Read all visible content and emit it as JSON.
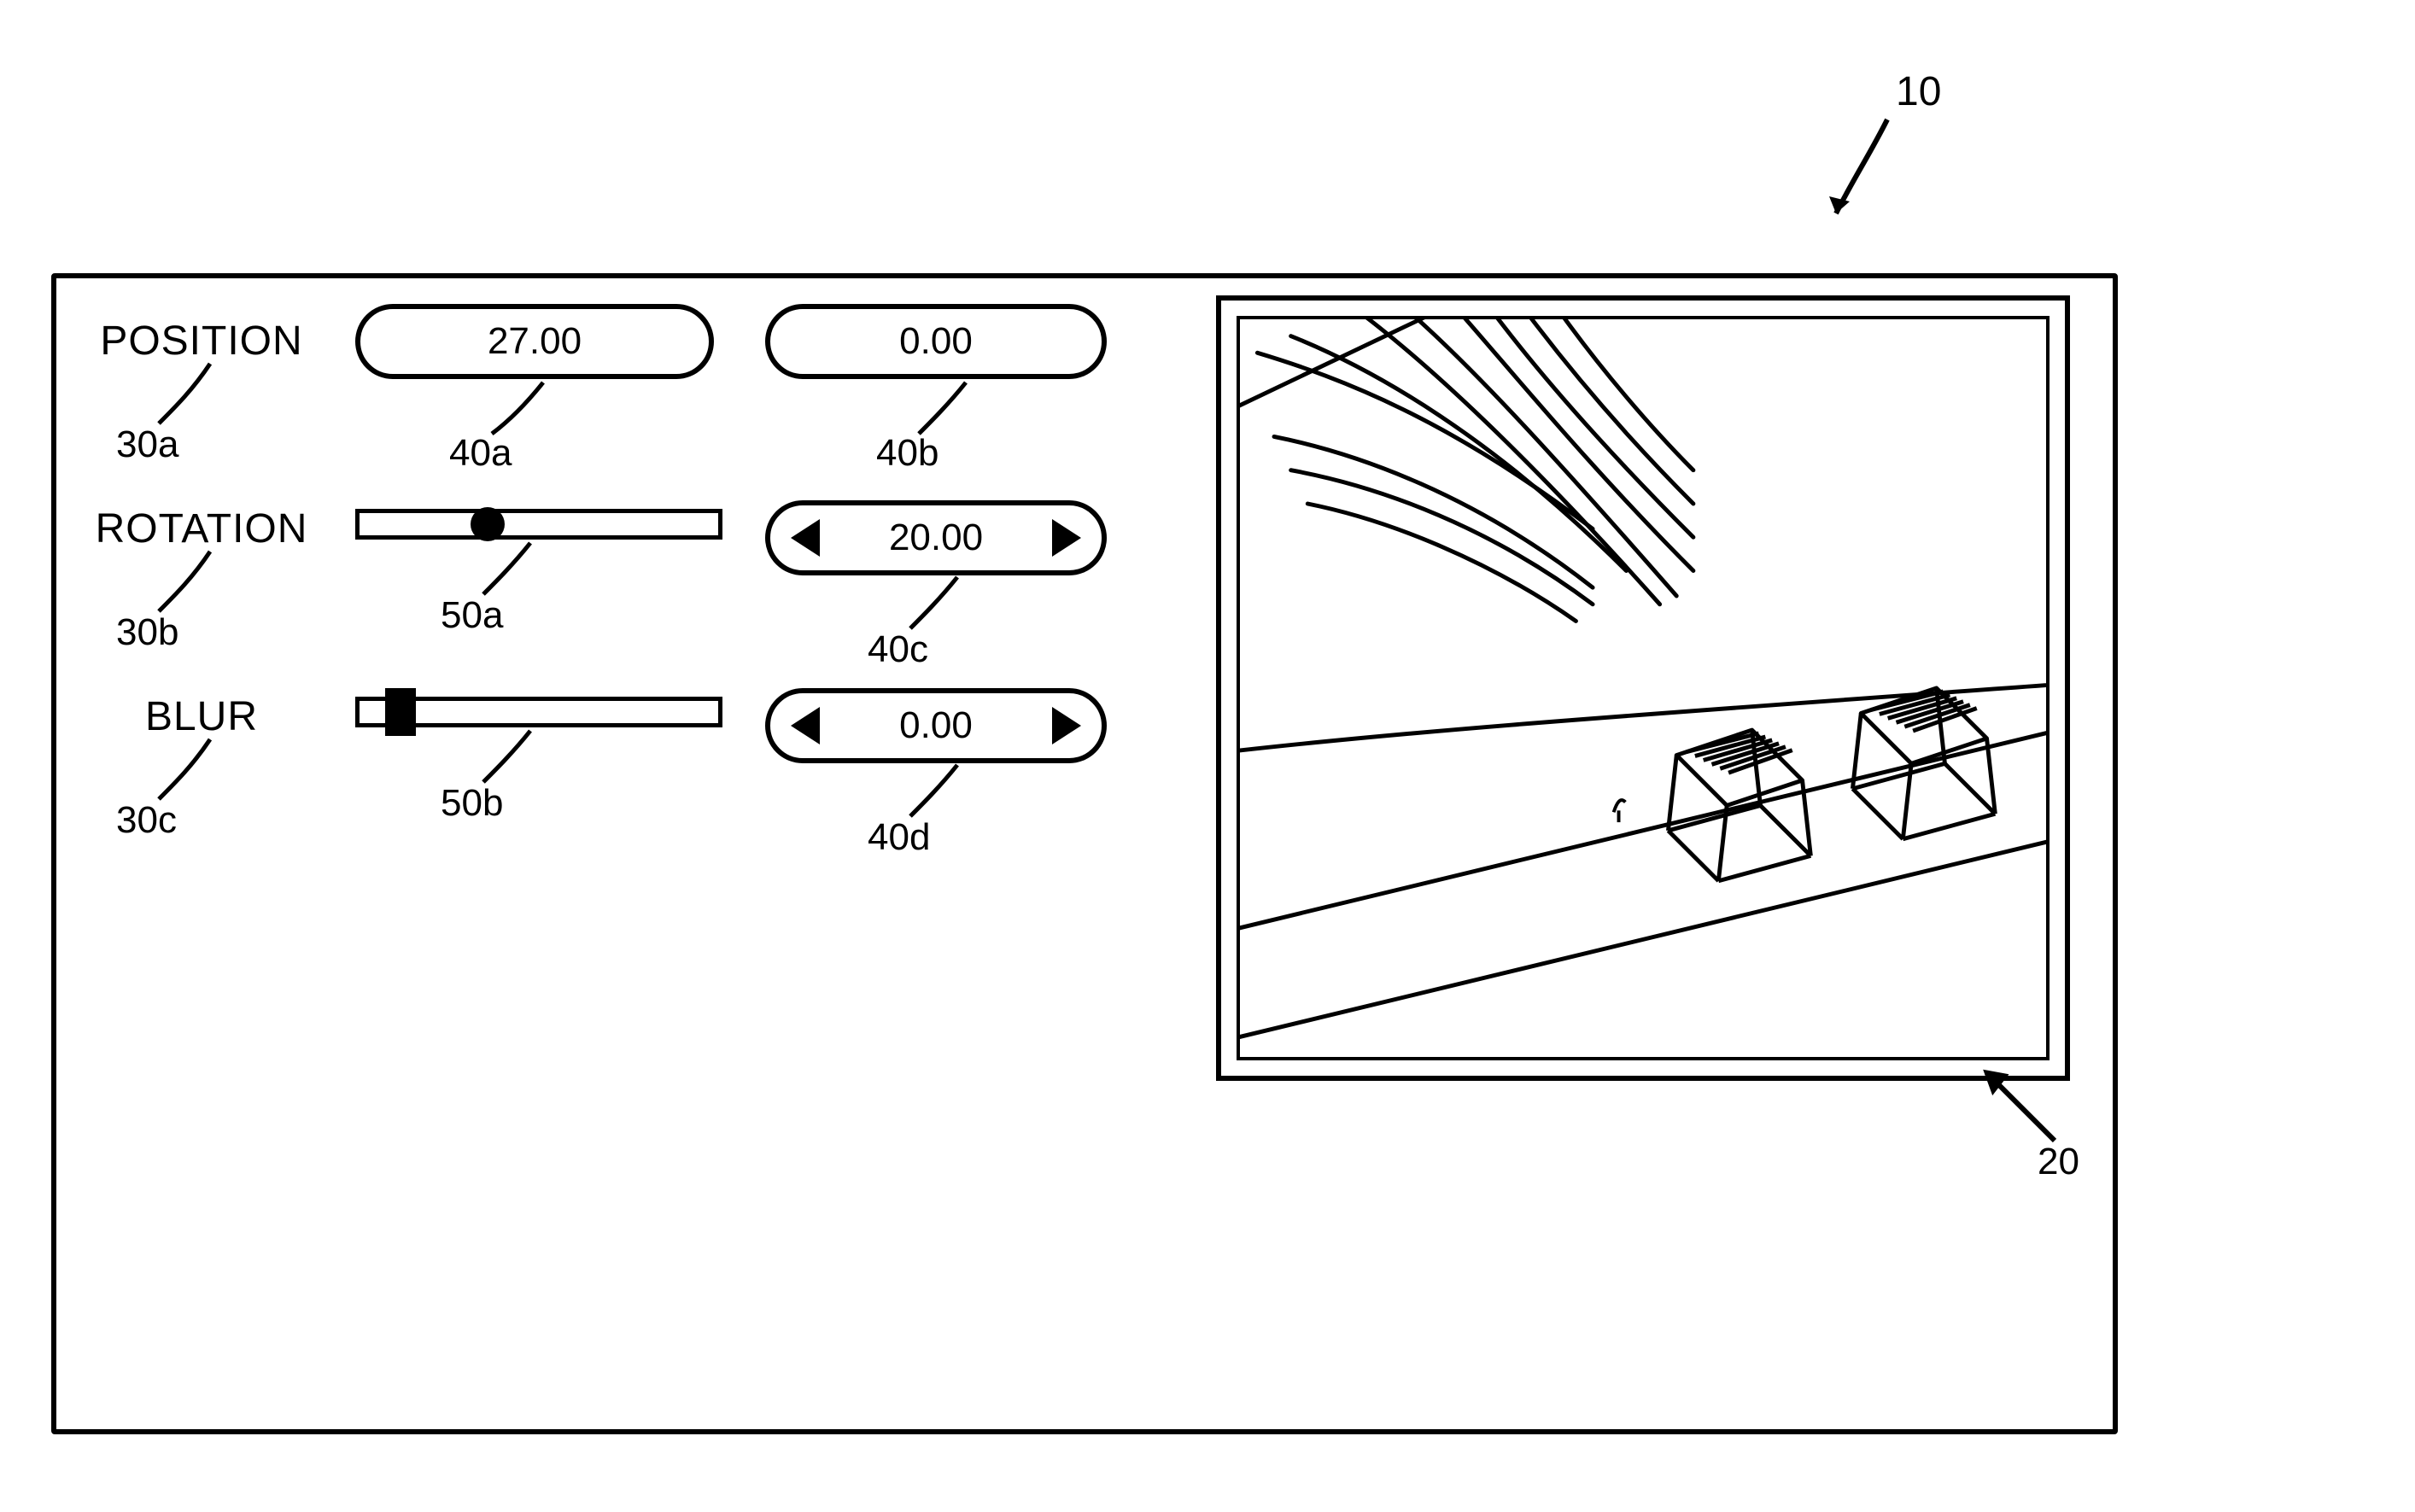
{
  "refs": {
    "figure": "10",
    "preview": "20",
    "label_position": "30a",
    "label_rotation": "30b",
    "label_blur": "30c",
    "pill_pos_x": "40a",
    "pill_pos_y": "40b",
    "pill_rot_val": "40c",
    "pill_blur_val": "40d",
    "slider_rot": "50a",
    "slider_blur": "50b"
  },
  "controls": {
    "position": {
      "label": "POSITION",
      "x": "27.00",
      "y": "0.00"
    },
    "rotation": {
      "label": "ROTATION",
      "slider_percent": 32,
      "value": "20.00"
    },
    "blur": {
      "label": "BLUR",
      "slider_percent": 8,
      "value": "0.00"
    }
  },
  "icons": {
    "dec": "◀",
    "inc": "▶"
  }
}
